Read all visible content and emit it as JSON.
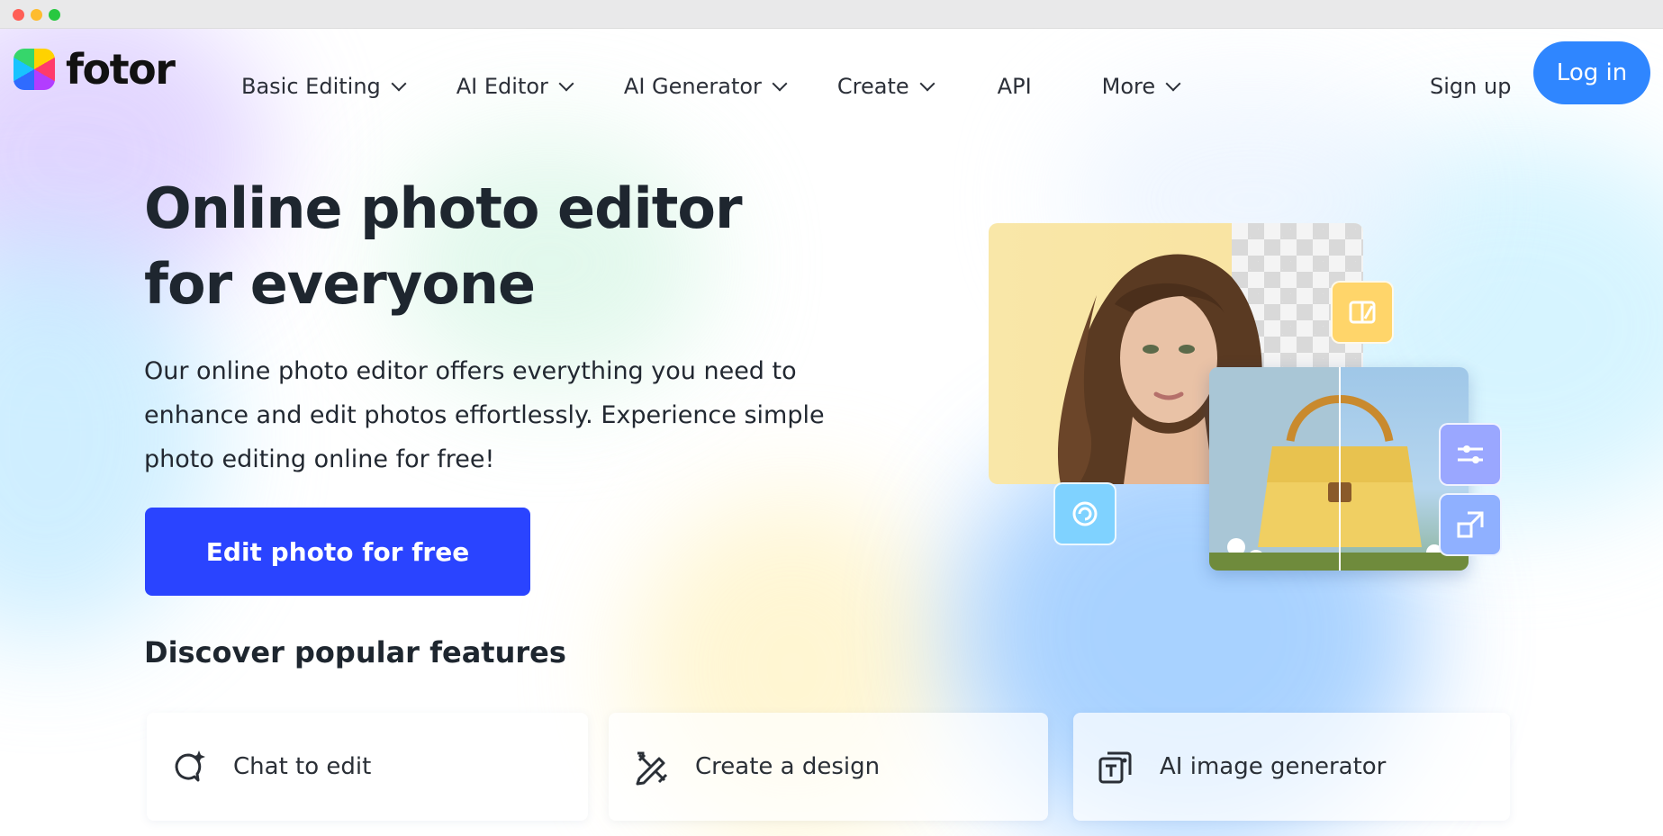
{
  "window": {
    "title": "fotor"
  },
  "brand": {
    "name": "fotor",
    "accent": "#2f86ff",
    "cta_color": "#2a44ff"
  },
  "nav": {
    "items": [
      {
        "label": "Basic Editing",
        "has_dropdown": true
      },
      {
        "label": "AI Editor",
        "has_dropdown": true
      },
      {
        "label": "AI Generator",
        "has_dropdown": true
      },
      {
        "label": "Create",
        "has_dropdown": true
      },
      {
        "label": "API",
        "has_dropdown": false
      },
      {
        "label": "More",
        "has_dropdown": true
      }
    ],
    "signup_label": "Sign up",
    "login_label": "Log in"
  },
  "hero": {
    "title": "Online photo editor for everyone",
    "description": "Our online photo editor offers everything you need to enhance and edit photos effortlessly. Experience simple photo editing online for free!",
    "cta_label": "Edit photo for free"
  },
  "features": {
    "heading": "Discover popular features",
    "cards": [
      {
        "label": "Chat to edit",
        "icon": "chat-sparkle-icon"
      },
      {
        "label": "Create a design",
        "icon": "design-tools-icon"
      },
      {
        "label": "AI image generator",
        "icon": "ai-text-image-icon"
      }
    ]
  },
  "hero_art": {
    "tools": [
      "compare-icon",
      "retouch-icon",
      "adjust-sliders-icon",
      "resize-icon"
    ]
  }
}
